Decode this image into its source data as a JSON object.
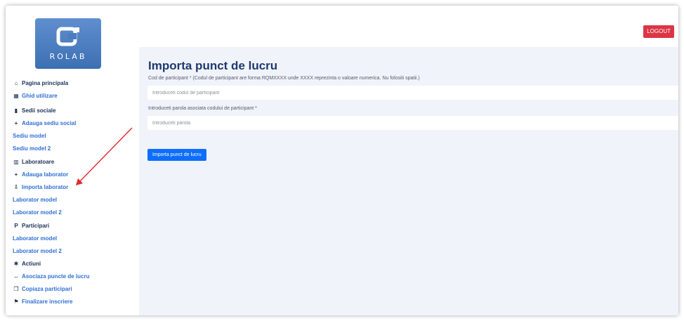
{
  "logo": {
    "text": "ROLAB"
  },
  "sidebar": {
    "items": [
      {
        "label": "Pagina principala",
        "icon": "home-icon",
        "glyph": "⌂",
        "style": "head"
      },
      {
        "label": "Ghid utilizare",
        "icon": "book-icon",
        "glyph": "▦",
        "style": "link"
      },
      {
        "label": "Sedii sociale",
        "icon": "building-icon",
        "glyph": "▮",
        "style": "head"
      },
      {
        "label": "Adauga sediu social",
        "icon": "plus-icon",
        "glyph": "+",
        "style": "link"
      },
      {
        "label": "Sediu model",
        "icon": "",
        "glyph": "",
        "style": "sub"
      },
      {
        "label": "Sediu model 2",
        "icon": "",
        "glyph": "",
        "style": "sub"
      },
      {
        "label": "Laboratoare",
        "icon": "lab-icon",
        "glyph": "▥",
        "style": "head"
      },
      {
        "label": "Adauga laborator",
        "icon": "plus-icon",
        "glyph": "+",
        "style": "link"
      },
      {
        "label": "Importa laborator",
        "icon": "import-icon",
        "glyph": "⇩",
        "style": "link"
      },
      {
        "label": "Laborator model",
        "icon": "",
        "glyph": "",
        "style": "sub"
      },
      {
        "label": "Laborator model 2",
        "icon": "",
        "glyph": "",
        "style": "sub"
      },
      {
        "label": "Participari",
        "icon": "participant-icon",
        "glyph": "P",
        "style": "head"
      },
      {
        "label": "Laborator model",
        "icon": "",
        "glyph": "",
        "style": "sub"
      },
      {
        "label": "Laborator model 2",
        "icon": "",
        "glyph": "",
        "style": "sub"
      },
      {
        "label": "Actiuni",
        "icon": "gear-icon",
        "glyph": "✱",
        "style": "head"
      },
      {
        "label": "Asociaza puncte de lucru",
        "icon": "link-arrows-icon",
        "glyph": "↔",
        "style": "link"
      },
      {
        "label": "Copiaza participari",
        "icon": "copy-icon",
        "glyph": "❐",
        "style": "link"
      },
      {
        "label": "Finalizare inscriere",
        "icon": "flag-icon",
        "glyph": "⚑",
        "style": "link"
      }
    ]
  },
  "header": {
    "logout_label": "LOGOUT"
  },
  "main": {
    "title": "Importa punct de lucru",
    "participant_code": {
      "label": "Cod de participant * (Codul de participant are forma RQMXXXX unde XXXX reprezinta o valoare numerica. Nu folositi spatii.)",
      "placeholder": "Introduceti codul de participant",
      "value": ""
    },
    "password": {
      "label": "Introduceti parola asociata codului de participant *",
      "placeholder": "Introduceti parola",
      "value": ""
    },
    "submit_label": "Importa punct de lucru"
  },
  "colors": {
    "accent": "#0d6efd",
    "logout": "#dc3545",
    "link": "#2f6fd6",
    "heading": "#1b3159",
    "annotation_arrow": "#e02828"
  }
}
